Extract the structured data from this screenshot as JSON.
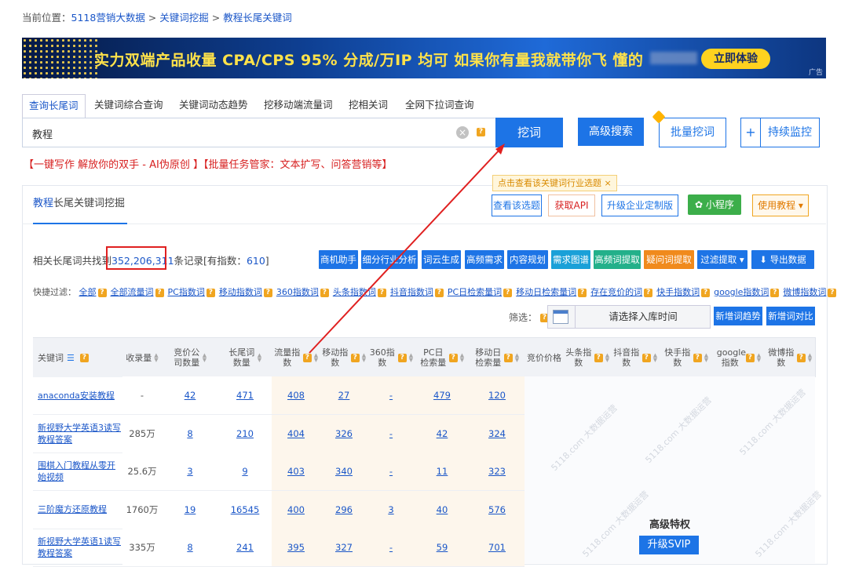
{
  "breadcrumb": {
    "prefix": "当前位置：",
    "items": [
      "5118营销大数据",
      "关键词挖掘",
      "教程长尾关键词"
    ],
    "sep": " > "
  },
  "banner": {
    "message": "实力双端产品收量 CPA/CPS 95% 分成/万IP 均可   如果你有量我就带你飞   懂的",
    "cta": "立即体验",
    "ad_label": "广告"
  },
  "tabs": [
    "查询长尾词",
    "关键词综合查询",
    "关键词动态趋势",
    "挖移动端流量词",
    "挖相关词",
    "全网下拉词查询"
  ],
  "search": {
    "value": "教程",
    "button": "挖词",
    "advanced": "高级搜索",
    "batch": "批量挖词",
    "monitor_plus": "+",
    "monitor": "持续监控"
  },
  "promo": "【一键写作 解放你的双手 - AI伪原创 】【批量任务管家：文本扩写、问答营销等】",
  "panel": {
    "title_kw": "教程",
    "title_rest": "长尾关键词挖掘",
    "tip": "点击查看该关键词行业选题  ×",
    "view_topic": "查看该选题",
    "get_api": "获取API",
    "enterprise": "升级企业定制版",
    "mini": "小程序",
    "guide": "使用教程 ▾"
  },
  "found": {
    "pre": "相关长尾词共找到",
    "num": "352,206,311",
    "mid": "条记录[有指数：",
    "idx": "610",
    "post": "]"
  },
  "filter_buttons": [
    {
      "label": "商机助手",
      "color": "#1d74e6"
    },
    {
      "label": "细分行业分析",
      "color": "#1d74e6"
    },
    {
      "label": "词云生成",
      "color": "#1d74e6"
    },
    {
      "label": "高频需求",
      "color": "#1d74e6"
    },
    {
      "label": "内容规划",
      "color": "#1d74e6"
    },
    {
      "label": "需求图谱",
      "color": "#1aa0d8"
    },
    {
      "label": "高频词提取",
      "color": "#23b08a"
    },
    {
      "label": "疑问词提取",
      "color": "#f08a1c"
    },
    {
      "label": "过滤提取 ▾",
      "color": "#1d74e6"
    },
    {
      "label": "⬇ 导出数据",
      "color": "#1d74e6"
    }
  ],
  "quick_filter": {
    "label": "快捷过滤：",
    "items": [
      "全部",
      "全部流量词",
      "PC指数词",
      "移动指数词",
      "360指数词",
      "头条指数词",
      "抖音指数词",
      "PC日检索量词",
      "移动日检索量词",
      "存在竞价的词",
      "快手指数词",
      "google指数词",
      "微博指数词"
    ]
  },
  "screen": {
    "label": "筛选：",
    "date_placeholder": "请选择入库时间",
    "new_trend": "新增词趋势",
    "new_compare": "新增词对比"
  },
  "table": {
    "headers": [
      "关键词",
      "收录量",
      "竞价公司数量",
      "长尾词数量",
      "流量指数",
      "移动指数",
      "360指数",
      "PC日检索量",
      "移动日检索量",
      "竞价价格",
      "头条指数",
      "抖音指数",
      "快手指数",
      "google指数",
      "微博指数"
    ],
    "rows": [
      {
        "kw_pre": "anaconda安装",
        "kw_hl": "教程",
        "kw_post": "",
        "shoulu": "-",
        "jingjia": "42",
        "changwei": "471",
        "liuliang": "408",
        "yidong": "27",
        "s360": "-",
        "pc": "479",
        "mobile": "120"
      },
      {
        "kw_pre": "新视野大学英语3读写",
        "kw_hl": "教程",
        "kw_post": "答案",
        "shoulu": "285万",
        "jingjia": "8",
        "changwei": "210",
        "liuliang": "404",
        "yidong": "326",
        "s360": "-",
        "pc": "42",
        "mobile": "324"
      },
      {
        "kw_pre": "围棋入门",
        "kw_hl": "教程",
        "kw_post": "从零开始视频",
        "shoulu": "25.6万",
        "jingjia": "3",
        "changwei": "9",
        "liuliang": "403",
        "yidong": "340",
        "s360": "-",
        "pc": "11",
        "mobile": "323"
      },
      {
        "kw_pre": "三阶魔方还原",
        "kw_hl": "教程",
        "kw_post": "",
        "shoulu": "1760万",
        "jingjia": "19",
        "changwei": "16545",
        "liuliang": "400",
        "yidong": "296",
        "s360": "3",
        "pc": "40",
        "mobile": "576"
      },
      {
        "kw_pre": "新视野大学英语1读写",
        "kw_hl": "教程",
        "kw_post": "答案",
        "shoulu": "335万",
        "jingjia": "8",
        "changwei": "241",
        "liuliang": "395",
        "yidong": "327",
        "s360": "-",
        "pc": "59",
        "mobile": "701"
      }
    ]
  },
  "vip": {
    "title": "高级特权",
    "button": "升级SVIP",
    "watermark": "5118.com 大数据运营"
  },
  "colors": {
    "accent": "#1d74e6",
    "highlight_red": "#e02020",
    "promo_red": "#d72020"
  }
}
